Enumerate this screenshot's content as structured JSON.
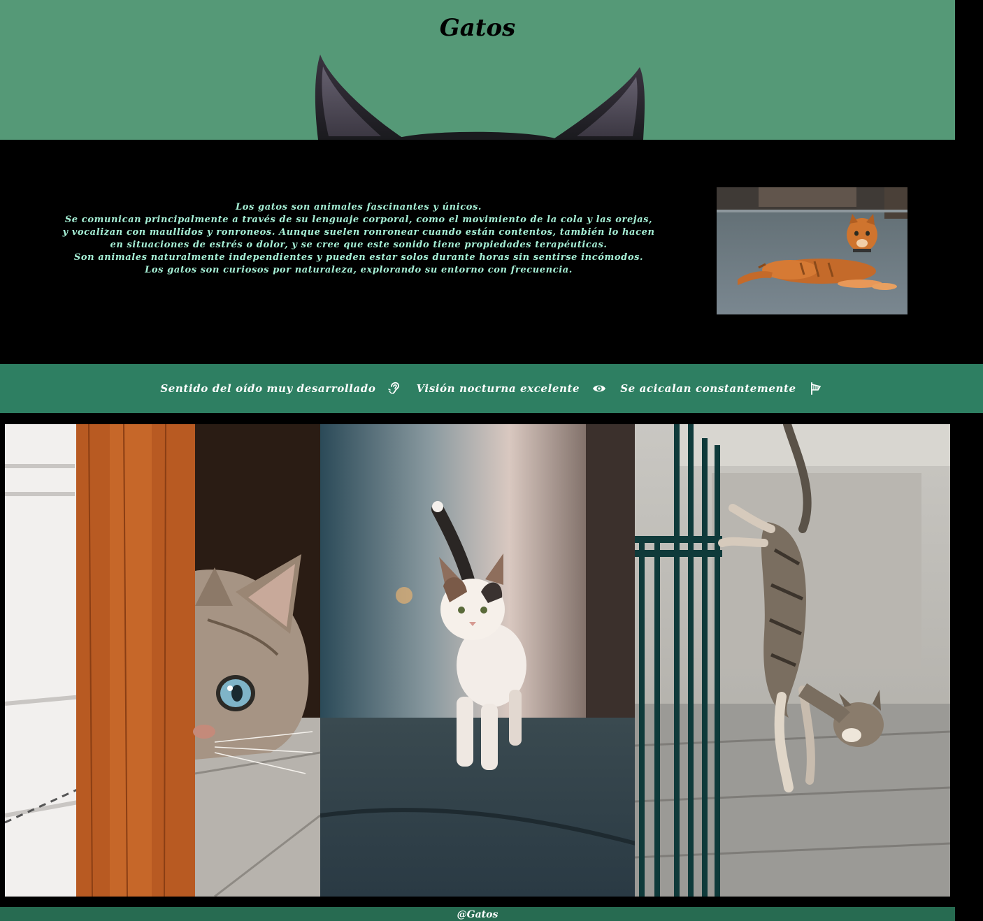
{
  "header": {
    "title": "Gatos",
    "background_color": "#559977"
  },
  "intro": {
    "paragraphs": [
      "Los gatos son animales fascinantes y únicos.",
      "Se comunican principalmente a través de su lenguaje corporal, como el movimiento de la cola y las orejas, y vocalizan con maullidos y ronroneos. Aunque suelen ronronear cuando están contentos, también lo hacen en situaciones de estrés o dolor, y se cree que este sonido tiene propiedades terapéuticas.",
      "Son animales naturalmente independientes y pueden estar solos durante horas sin sentirse incómodos.",
      "Los gatos son curiosos por naturaleza, explorando su entorno con frecuencia."
    ],
    "text_color": "#a6f0d6"
  },
  "features": {
    "background_color": "#2e7f62",
    "items": [
      {
        "label": "Sentido del oído muy desarrollado",
        "icon": "ear-listen-icon"
      },
      {
        "label": "Visión nocturna excelente",
        "icon": "eye-icon"
      },
      {
        "label": "Se acicalan constantemente",
        "icon": "brush-icon"
      }
    ]
  },
  "footer": {
    "text": "@Gatos",
    "background_color": "#276b51"
  }
}
